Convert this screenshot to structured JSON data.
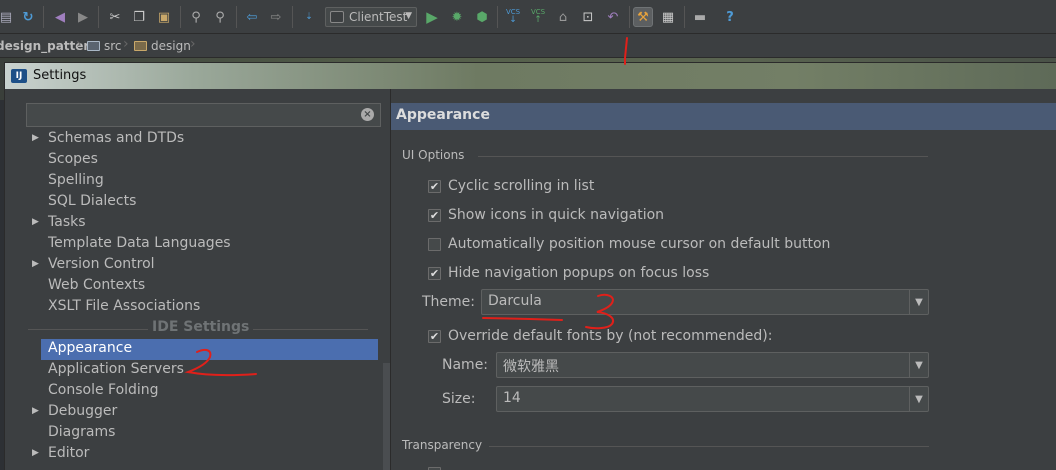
{
  "toolbar": {
    "run_config": "ClientTest",
    "vcs_label": "VCS"
  },
  "breadcrumb": {
    "project": "design_pattern",
    "src": "src",
    "design": "design"
  },
  "dialog": {
    "title": "Settings",
    "logo": "IJ"
  },
  "tree": {
    "items": [
      {
        "label": "Schemas and DTDs",
        "expandable": true
      },
      {
        "label": "Scopes",
        "expandable": false
      },
      {
        "label": "Spelling",
        "expandable": false
      },
      {
        "label": "SQL Dialects",
        "expandable": false
      },
      {
        "label": "Tasks",
        "expandable": true
      },
      {
        "label": "Template Data Languages",
        "expandable": false
      },
      {
        "label": "Version Control",
        "expandable": true
      },
      {
        "label": "Web Contexts",
        "expandable": false
      },
      {
        "label": "XSLT File Associations",
        "expandable": false
      }
    ],
    "section_header": "IDE Settings",
    "ide_items": [
      {
        "label": "Appearance",
        "expandable": false,
        "selected": true
      },
      {
        "label": "Application Servers",
        "expandable": false
      },
      {
        "label": "Console Folding",
        "expandable": false
      },
      {
        "label": "Debugger",
        "expandable": true
      },
      {
        "label": "Diagrams",
        "expandable": false
      },
      {
        "label": "Editor",
        "expandable": true
      }
    ]
  },
  "panel": {
    "title": "Appearance",
    "ui_options_label": "UI Options",
    "options": [
      {
        "label": "Cyclic scrolling in list",
        "checked": true
      },
      {
        "label": "Show icons in quick navigation",
        "checked": true
      },
      {
        "label": "Automatically position mouse cursor on default button",
        "checked": false
      },
      {
        "label": "Hide navigation popups on focus loss",
        "checked": true
      }
    ],
    "theme_label": "Theme:",
    "theme_value": "Darcula",
    "override_fonts": {
      "label": "Override default fonts by (not recommended):",
      "checked": true
    },
    "name_label": "Name:",
    "name_value": "微软雅黑",
    "size_label": "Size:",
    "size_value": "14",
    "transparency_label": "Transparency"
  },
  "annotations": {
    "one": "1",
    "two": "2",
    "three": "3"
  },
  "colors": {
    "background": "#3c3f41",
    "selection": "#4b6eaf",
    "header": "#4a5a74",
    "annotation": "#e0201a"
  }
}
